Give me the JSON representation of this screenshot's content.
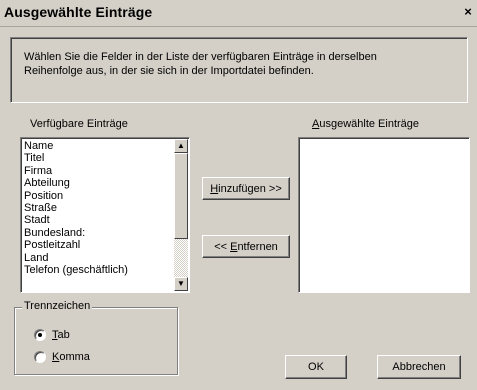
{
  "window": {
    "title": "Ausgewählte Einträge",
    "close_glyph": "×"
  },
  "instructions": {
    "line1": "Wählen Sie die Felder in der Liste der verfügbaren Einträge in derselben",
    "line2": "Reihenfolge aus, in der sie sich in der Importdatei befinden."
  },
  "available": {
    "label": "Verfügbare Einträge",
    "items": [
      "Name",
      "Titel",
      "Firma",
      "Abteilung",
      "Position",
      "Straße",
      "Stadt",
      "Bundesland:",
      "Postleitzahl",
      "Land",
      "Telefon (geschäftlich)"
    ]
  },
  "selected": {
    "label_mnemonic": "A",
    "label_rest": "usgewählte Einträge",
    "items": []
  },
  "buttons": {
    "add_mnemonic": "H",
    "add_rest": "inzufügen >>",
    "remove_prefix": "<< ",
    "remove_mnemonic": "E",
    "remove_rest": "ntfernen",
    "ok": "OK",
    "cancel": "Abbrechen"
  },
  "separator": {
    "title": "Trennzeichen",
    "options": [
      {
        "mnemonic": "T",
        "rest": "ab",
        "selected": true
      },
      {
        "mnemonic": "K",
        "rest": "omma",
        "selected": false
      }
    ]
  },
  "scrollbar": {
    "up_glyph": "▲",
    "down_glyph": "▼"
  }
}
